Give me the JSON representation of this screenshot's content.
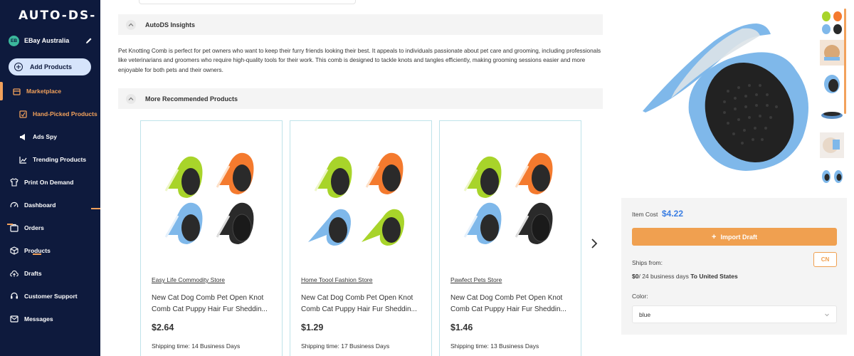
{
  "brand": {
    "logo_text": "AUTO-DS-"
  },
  "account": {
    "initials": "EB",
    "name": "EBay Australia"
  },
  "sidebar": {
    "add_products": "Add Products",
    "items": [
      {
        "label": "Marketplace",
        "icon": "store-icon"
      },
      {
        "label": "Hand-Picked Products",
        "icon": "handpicked-icon"
      },
      {
        "label": "Ads Spy",
        "icon": "megaphone-icon"
      },
      {
        "label": "Trending Products",
        "icon": "trending-icon"
      },
      {
        "label": "Print On Demand",
        "icon": "shirt-icon"
      },
      {
        "label": "Dashboard",
        "icon": "gauge-icon"
      },
      {
        "label": "Orders",
        "icon": "orders-icon"
      },
      {
        "label": "Products",
        "icon": "box-icon"
      },
      {
        "label": "Drafts",
        "icon": "cloud-upload-icon"
      },
      {
        "label": "Customer Support",
        "icon": "headset-icon"
      },
      {
        "label": "Messages",
        "icon": "mail-icon"
      }
    ]
  },
  "insights": {
    "heading": "AutoDS Insights",
    "text": "Pet Knotting Comb is perfect for pet owners who want to keep their furry friends looking their best. It appeals to individuals passionate about pet care and grooming, including professionals like veterinarians and groomers who require high-quality tools for their work. This comb is designed to tackle knots and tangles efficiently, making grooming sessions easier and more enjoyable for both pets and their owners."
  },
  "recommended": {
    "heading": "More Recommended Products",
    "cards": [
      {
        "store": "Easy Life Commodity Store",
        "title": "New Cat Dog Comb Pet Open Knot Comb Cat Puppy Hair Fur Sheddin...",
        "price": "$2.64",
        "shipping": "Shipping time: 14 Business Days"
      },
      {
        "store": "Home Toool Fashion Store",
        "title": "New Cat Dog Comb Pet Open Knot Comb Cat Puppy Hair Fur Sheddin...",
        "price": "$1.29",
        "shipping": "Shipping time: 17 Business Days"
      },
      {
        "store": "Pawfect Pets Store",
        "title": "New Cat Dog Comb Pet Open Knot Comb Cat Puppy Hair Fur Sheddin...",
        "price": "$1.46",
        "shipping": "Shipping time: 13 Business Days"
      }
    ]
  },
  "product": {
    "item_cost_label": "Item Cost",
    "item_cost": "$4.22",
    "import_label": "Import Draft",
    "ships_from_label": "Ships from:",
    "ships_from_value": "CN",
    "shipping_cost": "$0",
    "shipping_days": "/ 24 business days",
    "shipping_dest": "To United States",
    "color_label": "Color:",
    "color_value": "blue"
  },
  "colors": {
    "sidebar_bg": "#0e1a3d",
    "accent_orange": "#f0a050",
    "price_blue": "#3a7ee3",
    "comb_green": "#a8d42a",
    "comb_orange": "#f47a2e",
    "comb_blue": "#7fb8ea",
    "comb_black": "#2a2a2a"
  }
}
